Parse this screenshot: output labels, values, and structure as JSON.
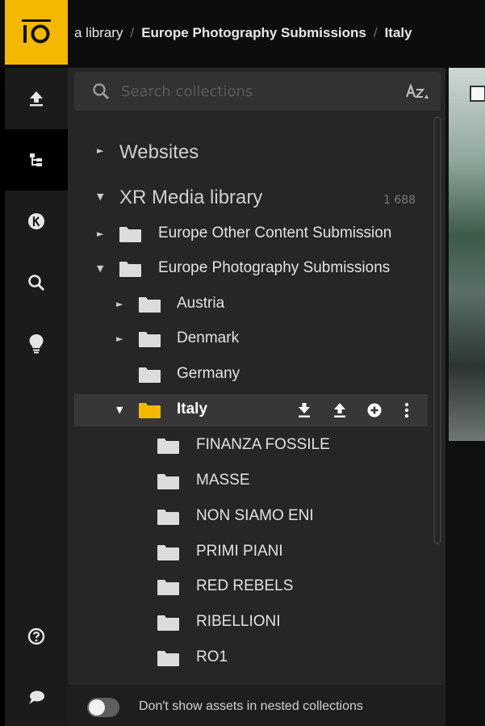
{
  "breadcrumb": {
    "items": [
      "a library",
      "Europe Photography Submissions",
      "Italy"
    ],
    "separator": "/"
  },
  "search": {
    "placeholder": "Search collections"
  },
  "tree": {
    "websites": "Websites",
    "root": {
      "label": "XR Media library",
      "count": "1 688"
    },
    "europe_other": "Europe Other Content Submission",
    "europe_photo": "Europe Photography Submissions",
    "austria": "Austria",
    "denmark": "Denmark",
    "germany": "Germany",
    "italy": "Italy",
    "italy_children": [
      "FINANZA FOSSILE",
      "MASSE",
      "NON SIAMO ENI",
      "PRIMI PIANI",
      "RED REBELS",
      "RIBELLIONI",
      "RO1"
    ]
  },
  "footer": {
    "toggle_label": "Don't show assets in nested collections"
  },
  "icons": {
    "logo": "logo-icon",
    "upload": "upload-icon",
    "tree": "tree-icon",
    "k": "k-icon",
    "search": "search-icon",
    "lightbulb": "lightbulb-icon",
    "help": "help-icon",
    "chat": "chat-icon",
    "download": "download-icon",
    "add": "add-circle-icon",
    "more": "more-vertical-icon",
    "sort": "sort-az-icon"
  },
  "colors": {
    "accent": "#f5b800",
    "selected_folder": "#f5b800",
    "folder": "#dcdcdc"
  }
}
